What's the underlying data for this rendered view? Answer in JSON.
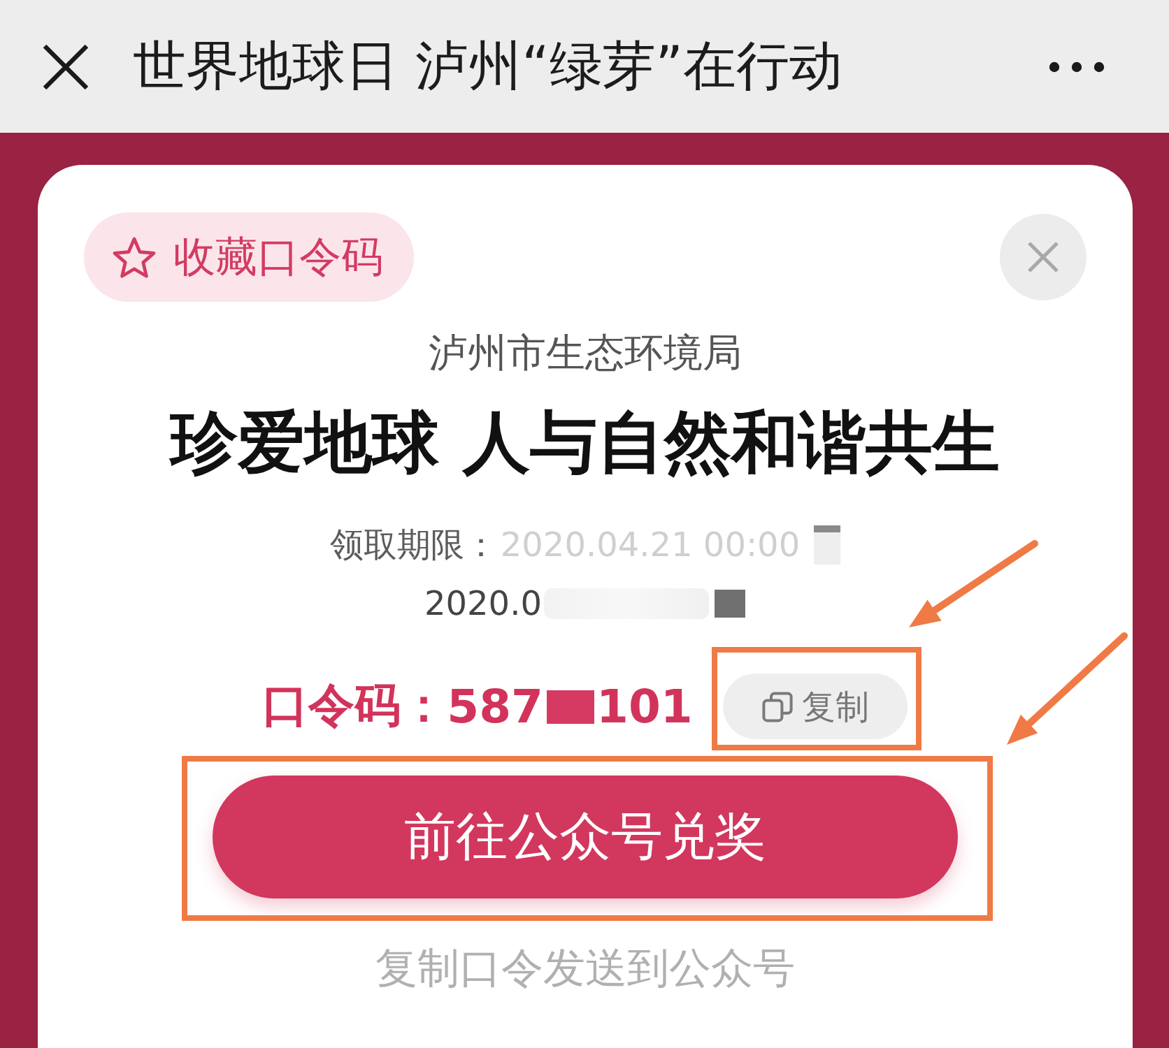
{
  "header": {
    "title": "世界地球日 泸州“绿芽”在行动"
  },
  "card": {
    "favorite_button": {
      "label": "收藏口令码"
    },
    "issuer": "泸州市生态环境局",
    "title": "珍爱地球 人与自然和谐共生",
    "deadline": [
      [
        {
          "kind": "label",
          "text": "领取期限："
        },
        {
          "kind": "faded",
          "text": "2020.04.21 00:00"
        },
        {
          "kind": "redacted"
        }
      ],
      [
        {
          "kind": "text",
          "text": "2020.0"
        },
        {
          "kind": "blurred"
        },
        {
          "kind": "redacted"
        }
      ]
    ],
    "code": {
      "label": "口令码：",
      "parts": [
        {
          "kind": "text",
          "text": "587"
        },
        {
          "kind": "redacted"
        },
        {
          "kind": "text",
          "text": "101"
        }
      ]
    },
    "copy_button": {
      "label": "复制",
      "highlighted": true
    },
    "redeem_button": {
      "label": "前往公众号兑奖",
      "highlighted": true
    },
    "hint": "复制口令发送到公众号"
  }
}
